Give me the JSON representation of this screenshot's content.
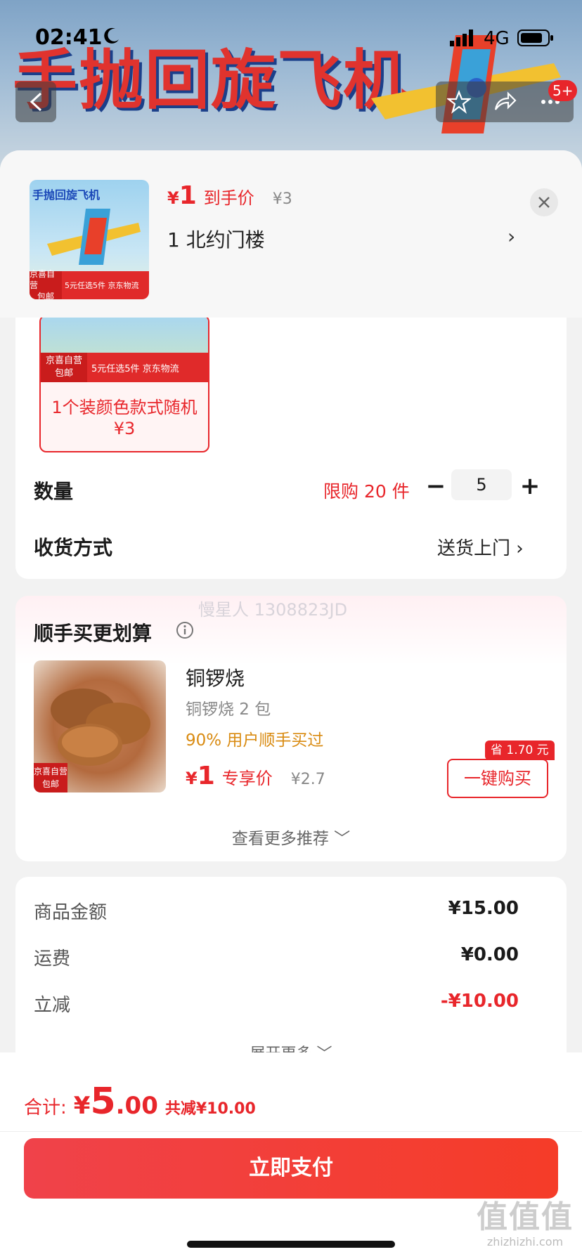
{
  "status_bar": {
    "time": "02:41",
    "network": "4G"
  },
  "banner": {
    "title": "手抛回旋飞机",
    "cart_badge": "5+"
  },
  "sheet_header": {
    "thumb_title": "手抛回旋飞机",
    "thumb_tag_top": "京喜自营",
    "thumb_tag_bottom": "包邮",
    "thumb_tag_right": "5元任选5件 京东物流",
    "price_symbol": "¥",
    "price": "1",
    "price_tag": "到手价",
    "original_price": "¥3",
    "address": "1  北约门楼",
    "address_chevron": "›"
  },
  "spec": {
    "tag_top": "京喜自营",
    "tag_bottom": "包邮",
    "tag_right": "5元任选5件 京东物流",
    "option_name": "1个装颜色款式随机",
    "option_price": "¥3"
  },
  "quantity": {
    "label": "数量",
    "limit": "限购 20 件",
    "minus": "−",
    "value": "5",
    "plus": "+"
  },
  "delivery": {
    "label": "收货方式",
    "value": "送货上门 ›"
  },
  "addon": {
    "watermark": "慢星人 1308823JD",
    "title": "顺手买更划算",
    "img_tag_top": "京喜自营",
    "img_tag_bottom": "包邮",
    "name": "铜锣烧",
    "desc": "铜锣烧 2 包",
    "stat": "90% 用户顺手买过",
    "price_symbol": "¥",
    "price": "1",
    "price_tag": "专享价",
    "original_price": "¥2.7",
    "save_badge": "省 1.70 元",
    "buy_button": "一键购买",
    "view_more": "查看更多推荐 ﹀"
  },
  "summary": {
    "rows": [
      {
        "label": "商品金额",
        "value": "¥15.00"
      },
      {
        "label": "运费",
        "value": "¥0.00"
      },
      {
        "label": "立减",
        "value": "-¥10.00"
      }
    ],
    "expand": "展开更多 ﹀"
  },
  "pay_bar": {
    "total_label": "合计:",
    "total_symbol": "¥",
    "total_int": "5",
    "total_dec": ".00",
    "total_discount": "共减¥10.00",
    "pay_button": "立即支付"
  },
  "site_watermark": {
    "big": "值值值",
    "small": "zhizhizhi.com"
  },
  "colors": {
    "accent": "#e8262b",
    "addon_stat": "#d98b12"
  }
}
